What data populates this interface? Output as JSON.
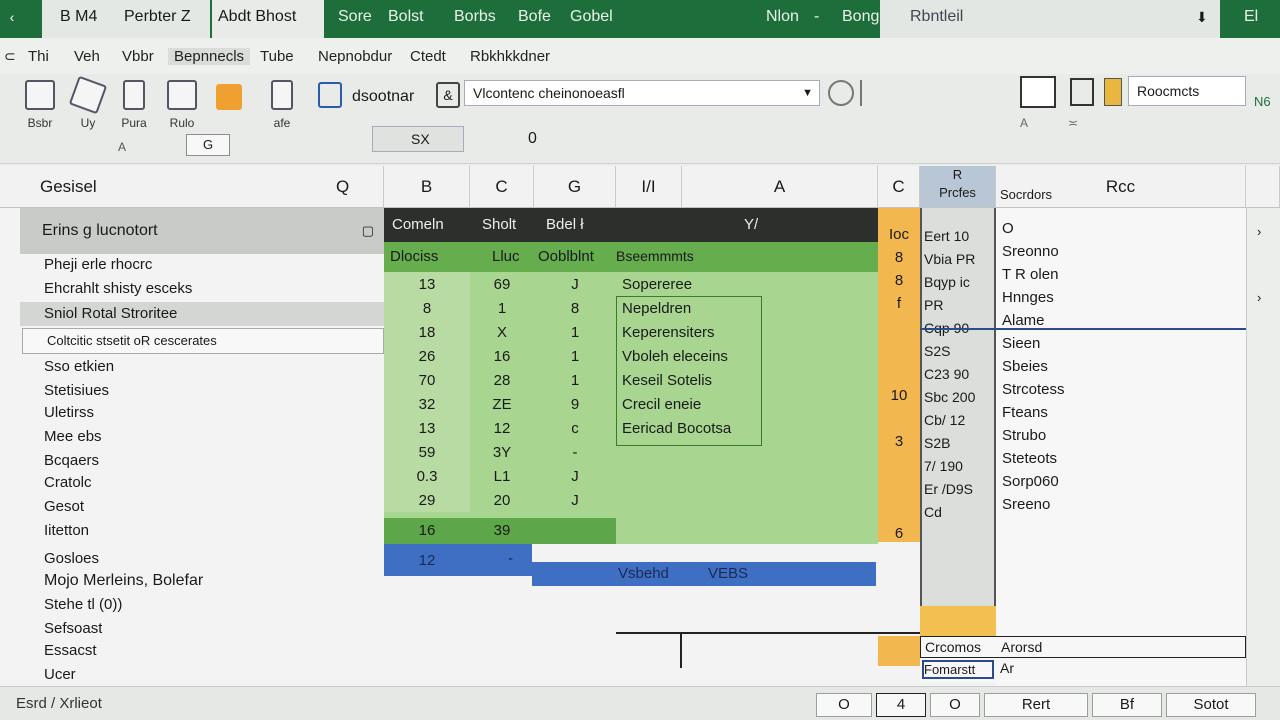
{
  "titlebar": {
    "file_short": "B M4",
    "file_name": "Perbter Z",
    "doc_title": "Abdt Bhost",
    "items": [
      "Sore",
      "Bolst",
      "Borbs",
      "Bofe",
      "Gobel",
      "Nlon",
      "-",
      "Bong"
    ],
    "view_label": "Rbntleil",
    "pin_icon": "pin-icon",
    "right_label": "El",
    "accent": "#1e6e3c"
  },
  "menu": {
    "items": [
      "Thi",
      "Veh",
      "Vbbr",
      "Bepnnecls",
      "Tube",
      "Nepnobdur",
      "Ctedt",
      "Rbkhkkdner"
    ]
  },
  "ribbon": {
    "tools": [
      {
        "icon": "grid-icon",
        "label": "Bsbr"
      },
      {
        "icon": "paint-icon",
        "label": "Uy"
      },
      {
        "icon": "page-icon",
        "label": "Pura"
      },
      {
        "icon": "table-icon",
        "label": "Rulo"
      },
      {
        "icon": "clip-icon",
        "label": "afe"
      }
    ],
    "sub_label": "A",
    "sub_value": "G",
    "name_box_label": "dsootnar",
    "formula_value": "Vlcontenc cheinonoeasfl",
    "cell_ref": "SX",
    "cell_value": "0",
    "right_field": "Roocmcts",
    "right_note": "N6"
  },
  "grid": {
    "name_header": "Gesisel",
    "col_headers": [
      "Q",
      "B",
      "C",
      "G",
      "I/I",
      "A",
      "C",
      "R",
      "Rcc"
    ],
    "col_header_sub": [
      "",
      "",
      "",
      "",
      "",
      "",
      "",
      "Prcfes",
      "Socrdors"
    ],
    "left_rows": [
      {
        "label": "Erins g lucnotort",
        "kind": "head"
      },
      {
        "label": "Pheji erle rhocrc",
        "kind": "text"
      },
      {
        "label": "Ehcrahlt shisty esceks",
        "kind": "text"
      },
      {
        "label": "Sniol Rotal Stroritee",
        "kind": "band"
      },
      {
        "label": "Coltcitic stsetit oR cescerates",
        "kind": "input"
      },
      {
        "label": "Sso etkien",
        "kind": "text"
      },
      {
        "label": "Stetisiues",
        "kind": "text"
      },
      {
        "label": "Uletirss",
        "kind": "text"
      },
      {
        "label": "Mee ebs",
        "kind": "text"
      },
      {
        "label": "Bcqaers",
        "kind": "text"
      },
      {
        "label": "Cratolc",
        "kind": "text"
      },
      {
        "label": "Gesot",
        "kind": "text"
      },
      {
        "label": "Iitetton",
        "kind": "text"
      },
      {
        "label": "Gosloes",
        "kind": "head2"
      },
      {
        "label": "Mojo Merleins, Bolefar",
        "kind": "text"
      },
      {
        "label": "Stehe tl (0))",
        "kind": "text"
      },
      {
        "label": "Sefsoast",
        "kind": "text"
      },
      {
        "label": "Essacst",
        "kind": "text"
      },
      {
        "label": "Ucer",
        "kind": "text"
      }
    ],
    "header_row": [
      "Comeln",
      "Sholt",
      "Bdel ł",
      "Y/"
    ],
    "sub_header": [
      "Dlociss",
      "Lluc",
      "Ooblblnt",
      "Bseemmmts"
    ],
    "data_rows": [
      [
        "13",
        "69",
        "J",
        "Sopereree"
      ],
      [
        "8",
        "1",
        "8",
        "Nepeldren"
      ],
      [
        "18",
        "X",
        "1",
        "Keperensiters"
      ],
      [
        "26",
        "16",
        "1",
        "Vboleh eleceins"
      ],
      [
        "70",
        "28",
        "1",
        "Keseil Sotelis"
      ],
      [
        "32",
        "ZE",
        "9",
        "Crecil eneie"
      ],
      [
        "13",
        "12",
        "c",
        "Eericad Bocotsa"
      ],
      [
        "59",
        "3Y",
        "-",
        ""
      ],
      [
        "0.3",
        "L1",
        "J",
        ""
      ],
      [
        "29",
        "20",
        "J",
        ""
      ]
    ],
    "total_row": [
      "16",
      "39"
    ],
    "summary_row": {
      "value": "12",
      "extra": "-",
      "label": "Vsbehd",
      "tag": "VEBS"
    },
    "orange_col": [
      "Ioc",
      "8",
      "8",
      "f",
      "",
      "",
      "",
      "10",
      "",
      "3",
      "",
      "",
      "",
      "6"
    ],
    "mid_col": [
      "Eert 10",
      "Vbia PR",
      "Bqyp ic",
      "PR",
      "Cqp 90",
      "S2S",
      "C23 90",
      "Sbc 200",
      "Cb/ 12",
      "S2B",
      "7/ 190",
      "Er /D9S",
      "Cd"
    ],
    "right_col": [
      "O",
      "Sreonno",
      "T R olen",
      "Hnnges",
      "Alame",
      "Sieen",
      "Sbeies",
      "Strcotess",
      "Fteans",
      "Strubo",
      "Steteots",
      "Sorp060",
      "Sreeno"
    ],
    "bottom_cells": [
      {
        "mid": "Crcomos",
        "right": "Arorsd"
      },
      {
        "mid": "Fomarstt",
        "right": "Ar"
      }
    ]
  },
  "statusbar": {
    "left": "Esrd / Xrlieot",
    "buttons": [
      "O",
      "4",
      "O",
      "Rert",
      "Bf",
      "Sotot"
    ],
    "icons": [
      "edit-icon",
      "arrow-icon"
    ]
  },
  "colors": {
    "green_header": "#1e6e3c",
    "green_band": "#7fbf66",
    "green_light": "#a8d590",
    "orange": "#f2b84f",
    "blue": "#3f6fc2",
    "dark_header": "#2c2f2c"
  }
}
